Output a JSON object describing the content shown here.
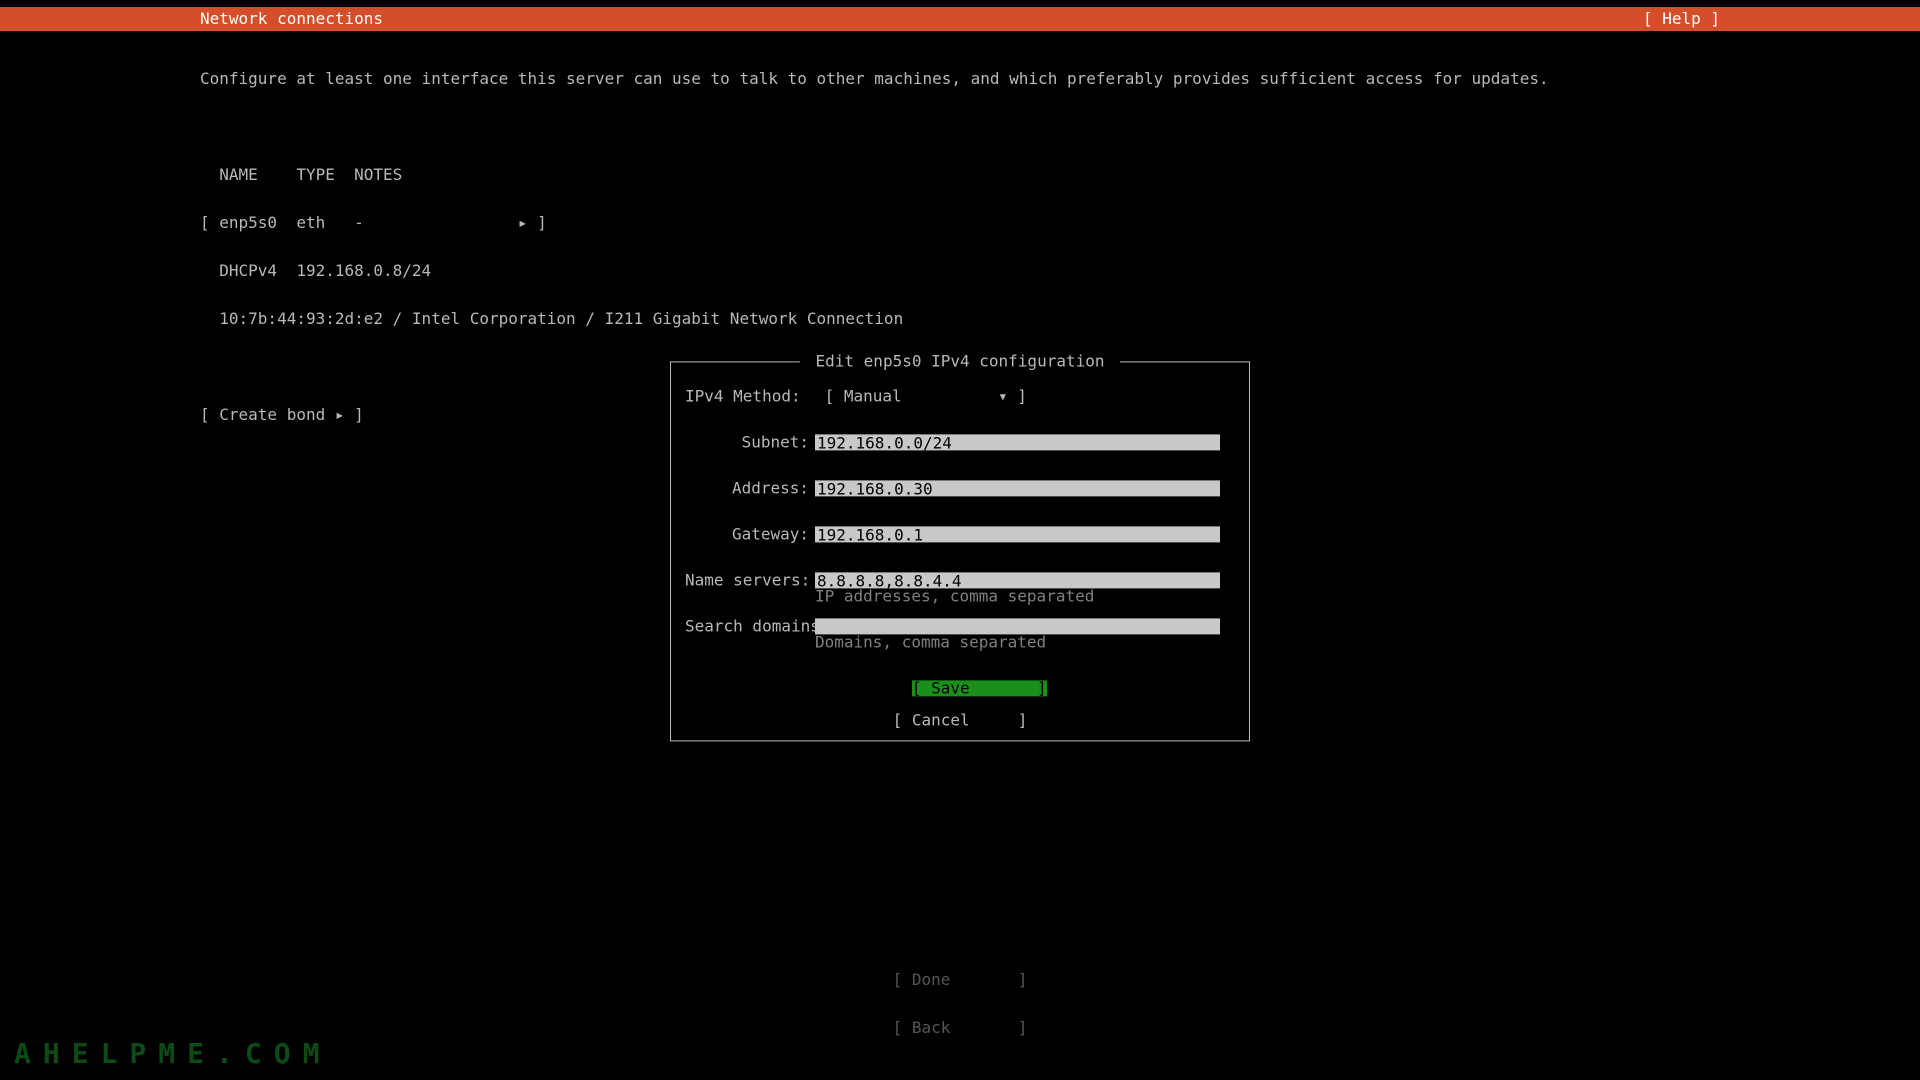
{
  "header": {
    "title": "Network connections",
    "help": "[ Help ]"
  },
  "instructions": "Configure at least one interface this server can use to talk to other machines, and which preferably provides sufficient access for updates.",
  "table": {
    "header": "  NAME    TYPE  NOTES",
    "row_iface": "[ enp5s0  eth   -                ▸ ]",
    "row_dhcp": "  DHCPv4  192.168.0.8/24",
    "row_hw": "  10:7b:44:93:2d:e2 / Intel Corporation / I211 Gigabit Network Connection"
  },
  "create_bond": "[ Create bond ▸ ]",
  "dialog": {
    "title": " Edit enp5s0 IPv4 configuration ",
    "method_label": "IPv4 Method:",
    "method_value": "[ Manual          ▾ ]",
    "fields": {
      "subnet_label": "Subnet:",
      "subnet_value": "192.168.0.0/24",
      "address_label": "Address:",
      "address_value": "192.168.0.30",
      "gateway_label": "Gateway:",
      "gateway_value": "192.168.0.1",
      "ns_label": "Name servers:",
      "ns_value": "8.8.8.8,8.8.4.4",
      "ns_hint": "IP addresses, comma separated",
      "search_label": "Search domains:",
      "search_value": "",
      "search_hint": "Domains, comma separated"
    },
    "save": "[ Save       ]",
    "cancel": "[ Cancel     ]"
  },
  "footer": {
    "done": "[ Done       ]",
    "back": "[ Back       ]"
  },
  "watermark": "AHELPME.COM"
}
